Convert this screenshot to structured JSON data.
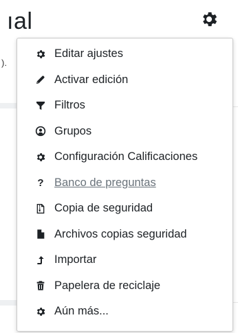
{
  "background": {
    "title_fragment": "ıal",
    "side_fragment": ")."
  },
  "menu": {
    "items": [
      {
        "label": "Editar ajustes",
        "icon": "gear-icon"
      },
      {
        "label": "Activar edición",
        "icon": "pencil-icon"
      },
      {
        "label": "Filtros",
        "icon": "filter-icon"
      },
      {
        "label": "Grupos",
        "icon": "user-circle-icon"
      },
      {
        "label": "Configuración Calificaciones",
        "icon": "gear-icon"
      },
      {
        "label": "Banco de preguntas",
        "icon": "question-mark-icon",
        "hovered": true
      },
      {
        "label": "Copia de seguridad",
        "icon": "file-archive-icon"
      },
      {
        "label": "Archivos copias seguridad",
        "icon": "file-icon"
      },
      {
        "label": "Importar",
        "icon": "level-up-icon"
      },
      {
        "label": "Papelera de reciclaje",
        "icon": "trash-icon"
      },
      {
        "label": "Aún más...",
        "icon": "gear-icon"
      }
    ]
  },
  "colors": {
    "text": "#1d2125",
    "hover_link": "#6a737b",
    "border": "#c9c9c9"
  }
}
